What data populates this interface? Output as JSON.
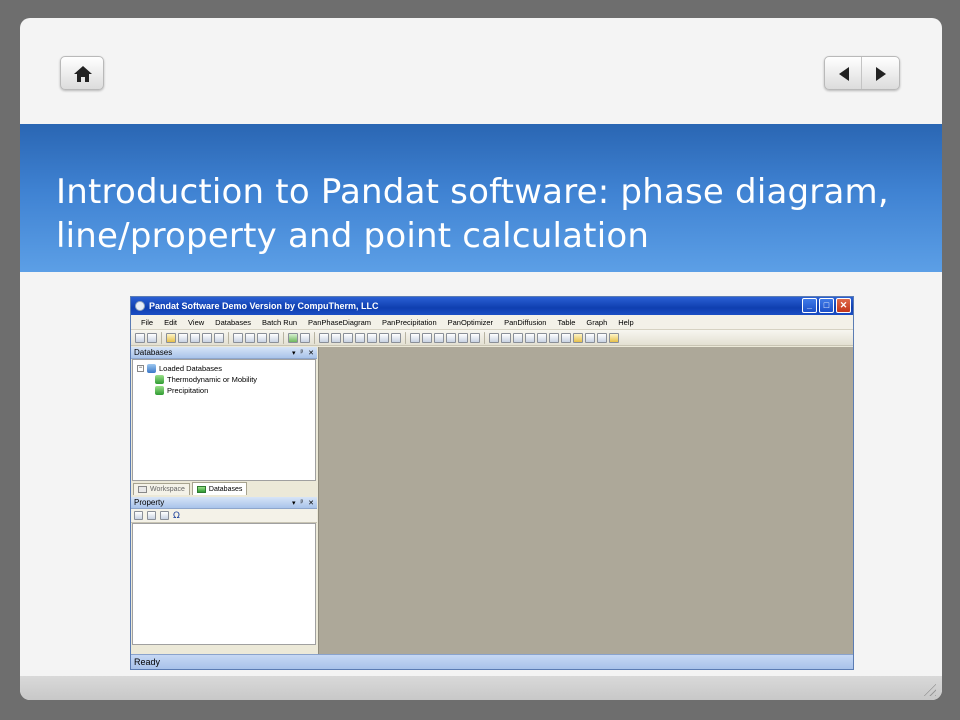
{
  "slide": {
    "title": "Introduction to Pandat software: phase diagram, line/property and point calculation"
  },
  "nav": {
    "home_icon": "home-icon",
    "prev_icon": "triangle-left-icon",
    "next_icon": "triangle-right-icon"
  },
  "app": {
    "window_title": "Pandat Software Demo Version by CompuTherm, LLC",
    "menu": [
      "File",
      "Edit",
      "View",
      "Databases",
      "Batch Run",
      "PanPhaseDiagram",
      "PanPrecipitation",
      "PanOptimizer",
      "PanDiffusion",
      "Table",
      "Graph",
      "Help"
    ],
    "window_controls": {
      "minimize": "_",
      "maximize": "□",
      "close": "✕"
    },
    "databases_panel": {
      "title": "Databases",
      "controls": [
        "▾",
        "ᵖ",
        "✕"
      ],
      "tree_root": "Loaded Databases",
      "tree_root_toggle": "−",
      "tree_children": [
        "Thermodynamic or Mobility",
        "Precipitation"
      ]
    },
    "tabs": [
      "Workspace",
      "Databases"
    ],
    "property_panel": {
      "title": "Property",
      "controls": [
        "▾",
        "ᵖ",
        "✕"
      ],
      "toolbar_symbol": "Ω"
    },
    "status": "Ready"
  },
  "colors": {
    "title_band_top": "#2a66b3",
    "title_band_bottom": "#5c9fe6",
    "workspace_bg": "#ada899"
  }
}
